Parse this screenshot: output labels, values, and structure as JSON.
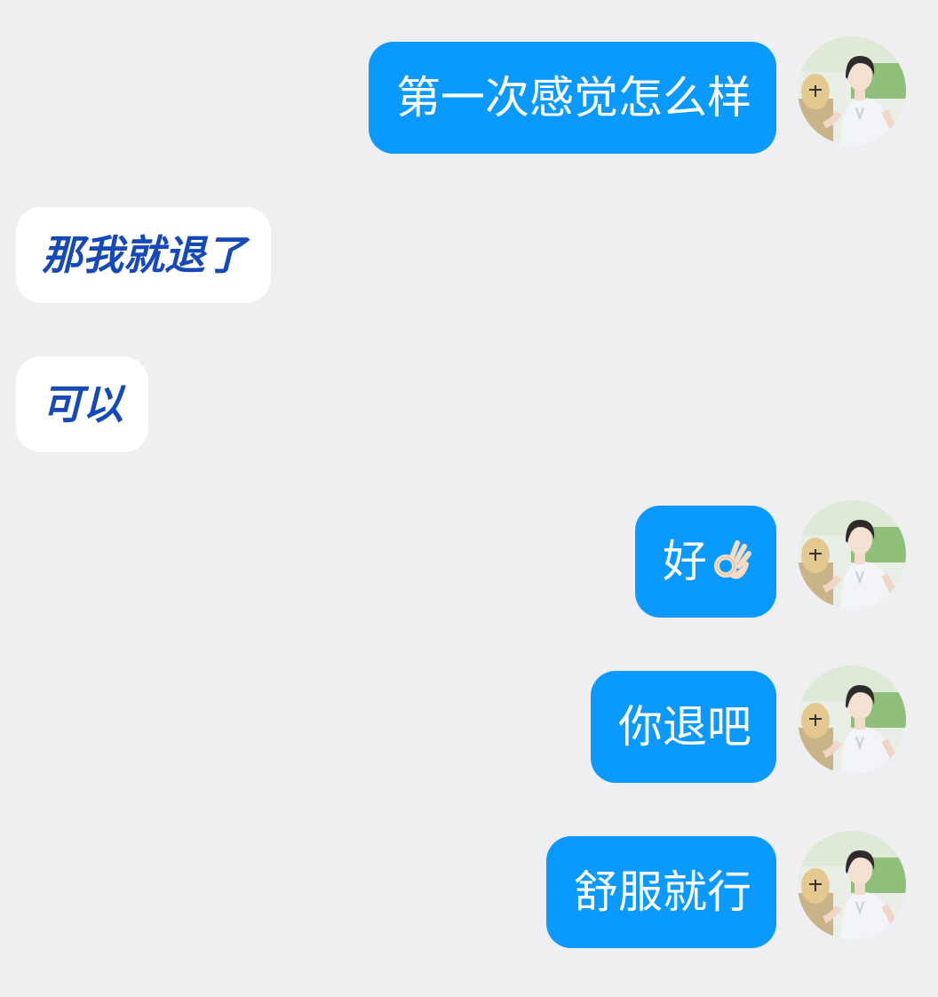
{
  "messages": [
    {
      "side": "sent",
      "text": "第一次感觉怎么样"
    },
    {
      "side": "received",
      "text": "那我就退了"
    },
    {
      "side": "received",
      "text": "可以"
    },
    {
      "side": "sent",
      "text": "好",
      "emoji": "ok-hand-icon"
    },
    {
      "side": "sent",
      "text": "你退吧"
    },
    {
      "side": "sent",
      "text": "舒服就行"
    }
  ],
  "colors": {
    "background": "#efeff2",
    "sent_bubble": "#0a99ff",
    "sent_text": "#ffffff",
    "received_bubble": "#ffffff",
    "received_text": "#1649b8"
  }
}
